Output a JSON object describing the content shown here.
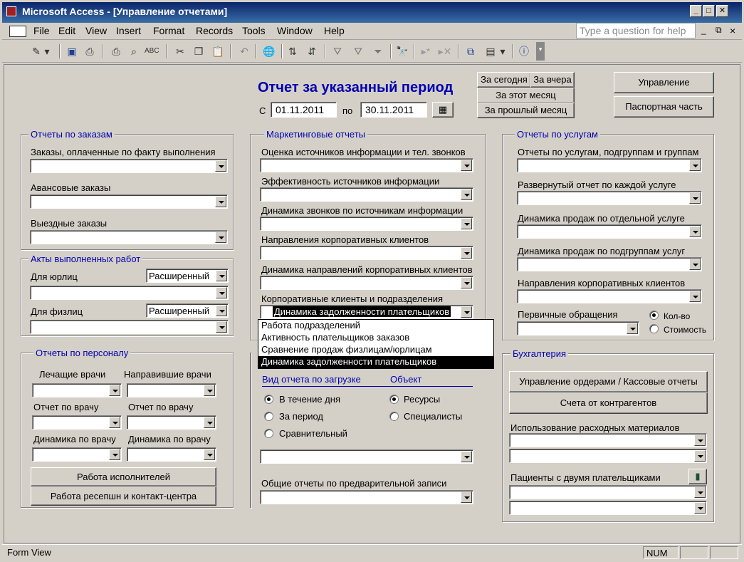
{
  "window": {
    "title": "Microsoft Access - [Управление отчетами]",
    "controls": {
      "minimize": "_",
      "maximize": "□",
      "close": "✕"
    }
  },
  "menubar": {
    "items": [
      "File",
      "Edit",
      "View",
      "Insert",
      "Format",
      "Records",
      "Tools",
      "Window",
      "Help"
    ],
    "help_placeholder": "Type a question for help",
    "doc_controls": [
      "_",
      "⧉",
      "×"
    ]
  },
  "toolbar": {
    "icons": [
      "view-icon",
      "save-icon",
      "file-search-icon",
      "print-icon",
      "print-preview-icon",
      "spelling-icon",
      "cut-icon",
      "copy-icon",
      "paste-icon",
      "undo-icon",
      "hyperlink-icon",
      "sort-ascending-icon",
      "sort-descending-icon",
      "filter-by-selection-icon",
      "filter-by-form-icon",
      "apply-filter-icon",
      "find-icon",
      "new-record-icon",
      "delete-record-icon",
      "database-window-icon",
      "new-object-icon",
      "help-icon"
    ]
  },
  "header": {
    "title": "Отчет за указанный период",
    "from_label": "С",
    "from_date": "01.11.2011",
    "to_label": "по",
    "to_date": "30.11.2011",
    "btn_today": "За сегодня",
    "btn_yesterday": "За вчера",
    "btn_this_month": "За этот месяц",
    "btn_last_month": "За прошлый месяц",
    "btn_management": "Управление",
    "btn_passport": "Паспортная часть"
  },
  "orders": {
    "title": "Отчеты по заказам",
    "paid": "Заказы, оплаченные по факту выполнения",
    "advance": "Авансовые заказы",
    "outbound": "Выездные заказы"
  },
  "acts": {
    "title": "Акты выполненных работ",
    "legal": "Для юрлиц",
    "legal_mode": "Расширенный",
    "individual": "Для физлиц",
    "individual_mode": "Расширенный"
  },
  "staff": {
    "title": "Отчеты по персоналу",
    "treating": "Лечащие врачи",
    "referring": "Направившие врачи",
    "report_doctor_1": "Отчет по врачу",
    "report_doctor_2": "Отчет по врачу",
    "dynamics_doctor_1": "Динамика по врачу",
    "dynamics_doctor_2": "Динамика по врачу",
    "btn_performers": "Работа исполнителей",
    "btn_reception": "Работа ресепшн и контакт-центра"
  },
  "marketing": {
    "title": "Маркетинговые отчеты",
    "labels": [
      "Оценка источников информации и тел. звонков",
      "Эффективность источников информации",
      "Динамика звонков по источникам информации",
      "Направления корпоративных клиентов",
      "Динамика направлений корпоративных клиентов",
      "Корпоративные клиенты и подразделения"
    ],
    "corp_value": "Динамика задолженности плательщиков",
    "dropdown": [
      "Работа подразделений",
      "Активность плательщиков заказов",
      "Сравнение продаж физлицам/юрлицам",
      "Динамика задолженности плательщиков"
    ]
  },
  "load": {
    "type_label": "Вид отчета по загрузке",
    "object_label": "Объект",
    "opt_day": "В течение дня",
    "opt_period": "За период",
    "opt_compare": "Сравнительный",
    "opt_resources": "Ресурсы",
    "opt_specialists": "Специалисты",
    "general_label": "Общие отчеты по предварительной записи"
  },
  "services": {
    "title": "Отчеты по услугам",
    "labels": [
      "Отчеты по услугам, подгруппам и группам",
      "Развернутый отчет по каждой услуге",
      "Динамика продаж по отдельной услуге",
      "Динамика продаж по подгруппам услуг",
      "Направления корпоративных клиентов",
      "Первичные обращения"
    ],
    "opt_count": "Кол-во",
    "opt_cost": "Стоимость"
  },
  "accounting": {
    "title": "Бухгалтерия",
    "btn_orders": "Управление ордерами / Кассовые отчеты",
    "btn_contractors": "Счета от контрагентов",
    "materials": "Использование расходных материалов",
    "two_payers": "Пациенты с двумя плательщиками"
  },
  "status": {
    "left": "Form View",
    "num": "NUM"
  }
}
